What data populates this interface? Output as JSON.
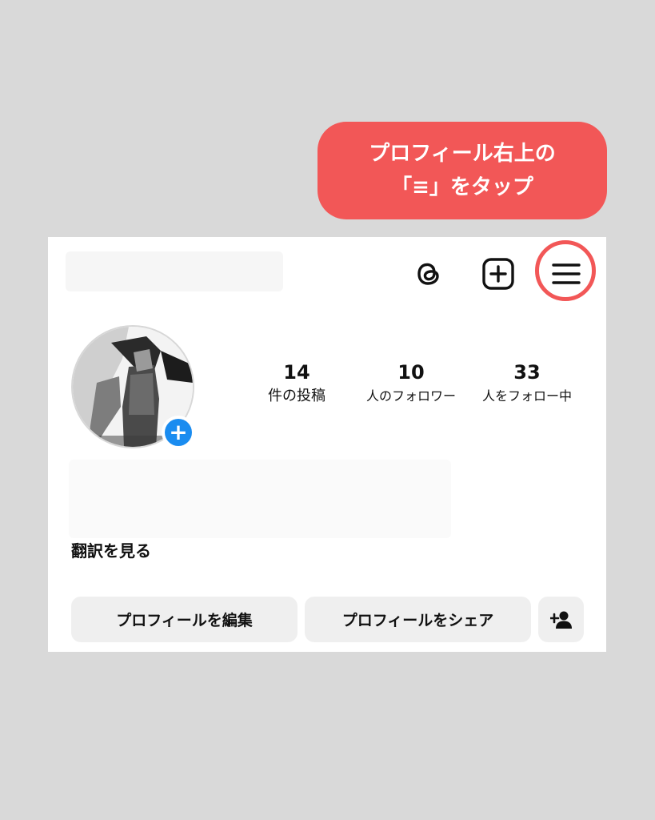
{
  "callout": {
    "line1": "プロフィール右上の",
    "line2": "「≡」をタップ"
  },
  "header": {
    "icons": [
      "threads-icon",
      "new-post-icon",
      "menu-icon"
    ]
  },
  "avatar": {
    "add_icon": "+"
  },
  "stats": {
    "posts": {
      "value": "14",
      "label": "件の投稿"
    },
    "followers": {
      "value": "10",
      "label": "人のフォロワー"
    },
    "following": {
      "value": "33",
      "label": "人をフォロー中"
    }
  },
  "bio": {
    "translate_label": "翻訳を見る"
  },
  "buttons": {
    "edit_profile": "プロフィールを編集",
    "share_profile": "プロフィールをシェア",
    "add_user_icon": "person-add-icon"
  },
  "colors": {
    "accent": "#f25757",
    "blue": "#1a8cf0",
    "button_bg": "#efefef",
    "page_bg": "#d9d9d9"
  }
}
